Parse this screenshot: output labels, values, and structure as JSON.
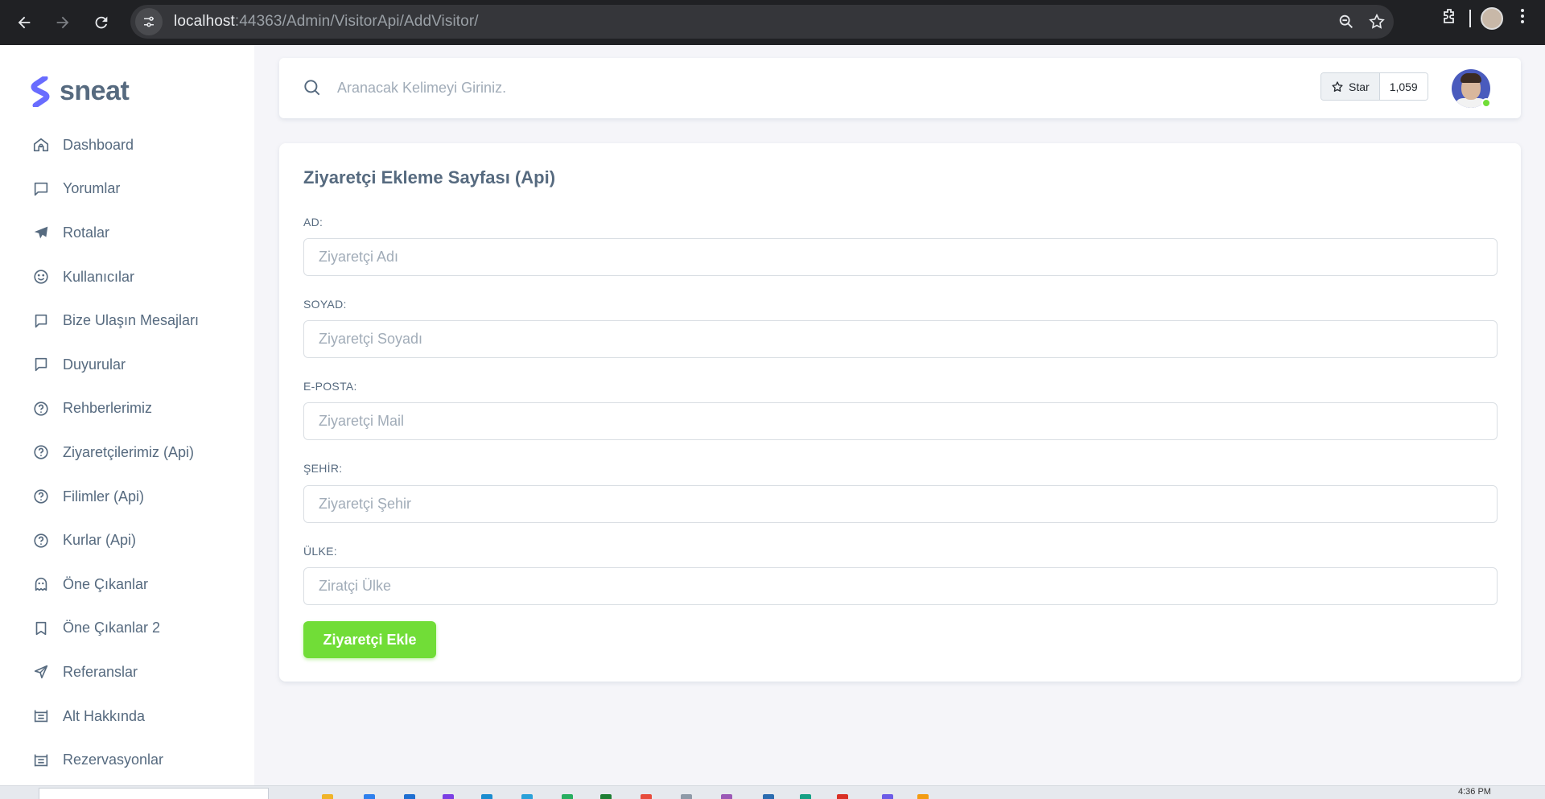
{
  "browser": {
    "url_host": "localhost",
    "url_rest": ":44363/Admin/VisitorApi/AddVisitor/"
  },
  "brand": {
    "name": "sneat",
    "color": "#696cff"
  },
  "sidebar": {
    "items": [
      {
        "label": "Dashboard",
        "icon": "home-icon"
      },
      {
        "label": "Yorumlar",
        "icon": "comment-icon"
      },
      {
        "label": "Rotalar",
        "icon": "plane-icon"
      },
      {
        "label": "Kullanıcılar",
        "icon": "smile-icon"
      },
      {
        "label": "Bize Ulaşın Mesajları",
        "icon": "message-icon"
      },
      {
        "label": "Duyurular",
        "icon": "message-icon"
      },
      {
        "label": "Rehberlerimiz",
        "icon": "help-circle-icon"
      },
      {
        "label": "Ziyaretçilerimiz (Api)",
        "icon": "help-circle-icon"
      },
      {
        "label": "Filimler (Api)",
        "icon": "help-circle-icon"
      },
      {
        "label": "Kurlar (Api)",
        "icon": "help-circle-icon"
      },
      {
        "label": "Öne Çıkanlar",
        "icon": "ghost-icon"
      },
      {
        "label": "Öne Çıkanlar 2",
        "icon": "book-icon"
      },
      {
        "label": "Referanslar",
        "icon": "send-icon"
      },
      {
        "label": "Alt Hakkında",
        "icon": "list-icon"
      },
      {
        "label": "Rezervasyonlar",
        "icon": "list-icon"
      }
    ]
  },
  "navbar": {
    "search_placeholder": "Aranacak Kelimeyi Giriniz.",
    "star_label": "Star",
    "star_count": "1,059"
  },
  "form": {
    "title": "Ziyaretçi Ekleme Sayfası (Api)",
    "fields": [
      {
        "label": "AD:",
        "placeholder": "Ziyaretçi Adı"
      },
      {
        "label": "SOYAD:",
        "placeholder": "Ziyaretçi Soyadı"
      },
      {
        "label": "E-POSTA:",
        "placeholder": "Ziyaretçi Mail"
      },
      {
        "label": "ŞEHİR:",
        "placeholder": "Ziyaretçi Şehir"
      },
      {
        "label": "ÜLKE:",
        "placeholder": "Ziratçi Ülke"
      }
    ],
    "submit_label": "Ziyaretçi Ekle",
    "submit_color": "#71dd37"
  },
  "taskbar": {
    "time": "4:36 PM"
  },
  "colors": {
    "text": "#566a7f",
    "placeholder": "#a1acb8",
    "background": "#f5f5f9",
    "online": "#71dd37"
  }
}
